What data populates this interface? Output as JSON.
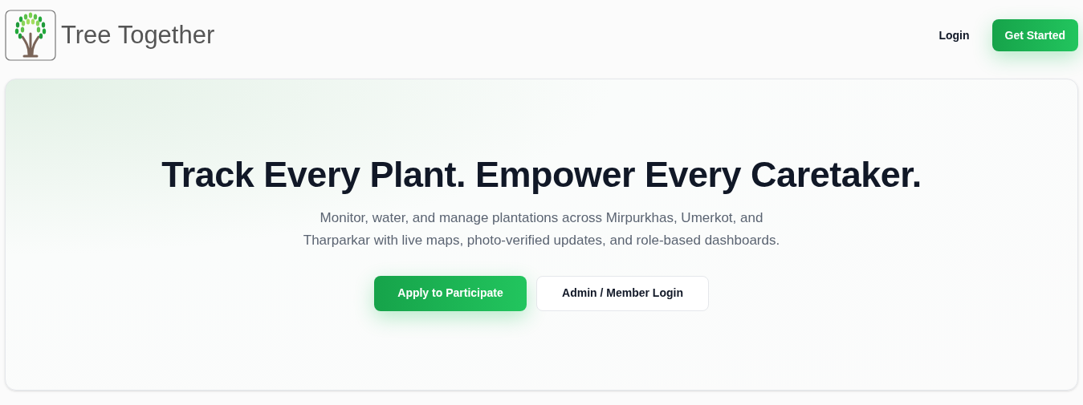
{
  "header": {
    "logo_text": "Tree Together",
    "nav": [
      {
        "label": "Login",
        "kind": "link"
      },
      {
        "label": "Get Started",
        "kind": "primary"
      }
    ]
  },
  "hero": {
    "title": "Track Every Plant. Empower Every Caretaker.",
    "lines": [
      "Monitor, water, and manage plantations across Mirpurkhas, Umerkot, and",
      "Tharparkar with live maps, photo-verified updates, and role-based dashboards."
    ],
    "buttons": [
      {
        "label": "Apply to Participate",
        "kind": "primary"
      },
      {
        "label": "Admin / Member Login",
        "kind": "secondary"
      }
    ]
  }
}
